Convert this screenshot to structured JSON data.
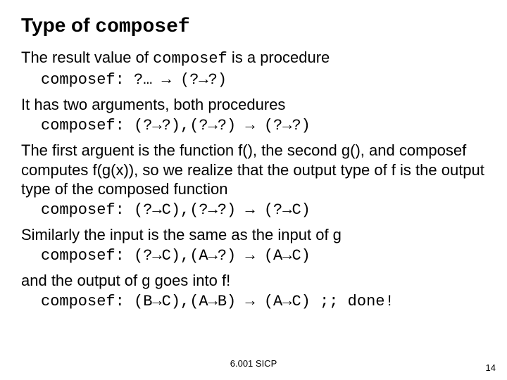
{
  "title_prefix": "Type of ",
  "title_mono": "composef",
  "p1_text": "The result value of ",
  "p1_mono": "composef",
  "p1_tail": " is a procedure",
  "p1_sig": "composef: ?… → (?→?)",
  "p2_text": "It has two arguments, both procedures",
  "p2_sig": "composef: (?→?),(?→?) → (?→?)",
  "p3_text": "The first arguent is the function f(), the second g(), and composef computes f(g(x)), so we realize that the output type of f is the output type of the composed function",
  "p3_sig": "composef: (?→C),(?→?) → (?→C)",
  "p4_text": "Similarly the input is the same as the input of g",
  "p4_sig": "composef: (?→C),(A→?) → (A→C)",
  "p5_text": "and the output of g goes into f!",
  "p5_sig": "composef: (B→C),(A→B) → (A→C)  ;; done!",
  "footer_center": "6.001 SICP",
  "footer_right": "14"
}
